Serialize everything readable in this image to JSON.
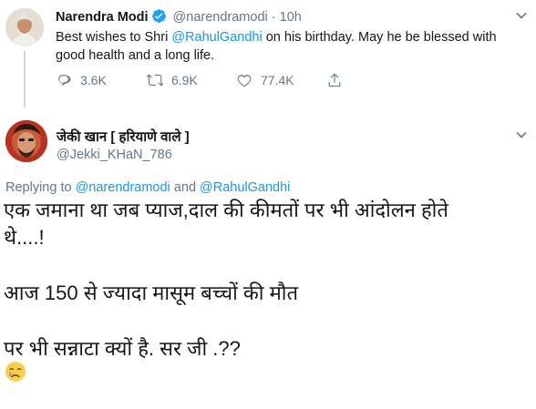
{
  "parent_tweet": {
    "display_name": "Narendra Modi",
    "handle": "@narendramodi",
    "separator": "·",
    "time": "10h",
    "text_before": "Best wishes to Shri ",
    "mention": "@RahulGandhi",
    "text_after": " on his birthday. May he be blessed with good health and a long life.",
    "stats": {
      "replies": "3.6K",
      "retweets": "6.9K",
      "likes": "77.4K"
    }
  },
  "reply_tweet": {
    "display_name": "जेकी खान [ हरियाणे वाले ]",
    "handle": "@Jekki_KHaN_786",
    "replying_prefix": "Replying to ",
    "replying_to_1": "@narendramodi",
    "replying_and": " and ",
    "replying_to_2": "@RahulGandhi",
    "lines": [
      "एक जमाना था जब प्याज,दाल की कीमतों पर भी आंदोलन होते",
      "थे....!",
      "आज 150 से ज्यादा मासूम बच्चों की मौत",
      "पर भी सन्नाटा क्यों है.  सर जी .??"
    ],
    "emoji": "crying-face"
  },
  "colors": {
    "link": "#1b95e0",
    "muted": "#657786",
    "verified": "#1da1f2",
    "thread_line": "#ccd6dd"
  }
}
